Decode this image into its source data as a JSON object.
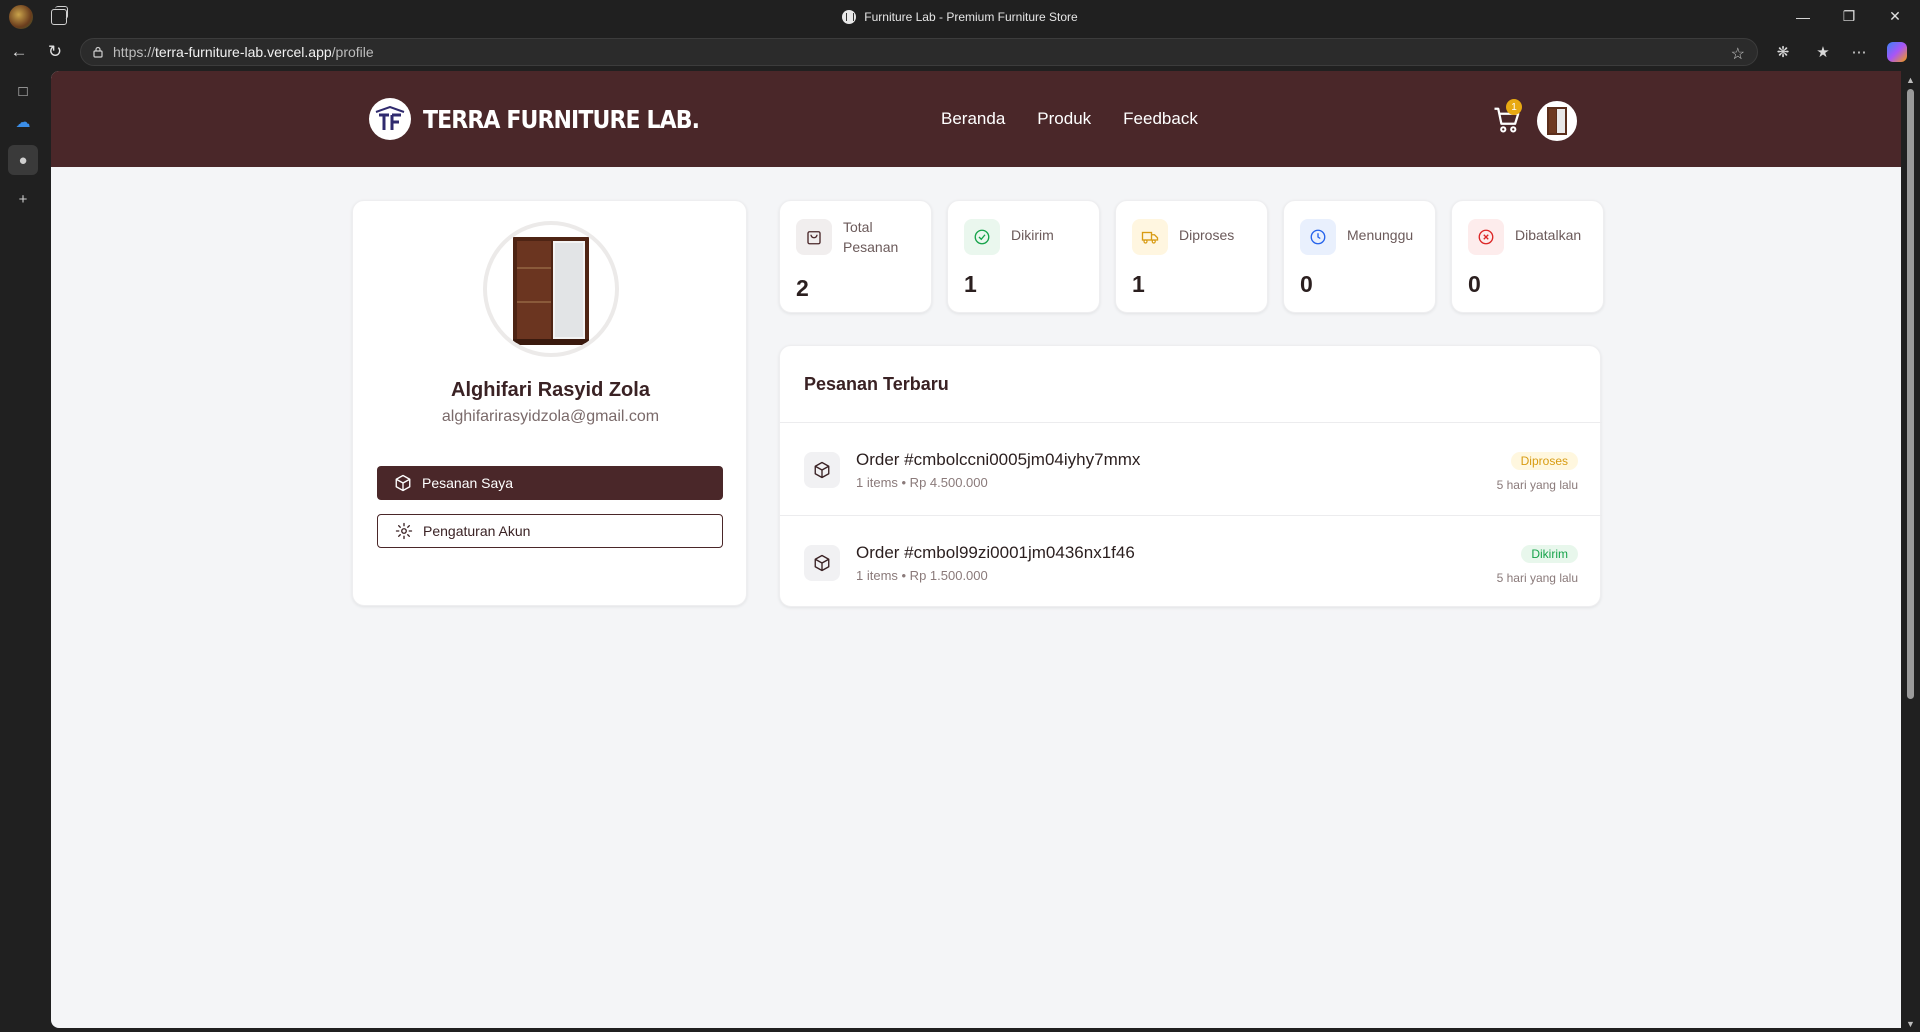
{
  "browser": {
    "tab_title": "Furniture Lab - Premium Furniture Store",
    "url_scheme": "https://",
    "url_host": "terra-furniture-lab.vercel.app",
    "url_path": "/profile"
  },
  "site": {
    "brand": "TERRA FURNITURE LAB.",
    "nav": [
      "Beranda",
      "Produk",
      "Feedback"
    ],
    "cart_count": "1"
  },
  "profile": {
    "name": "Alghifari Rasyid Zola",
    "email": "alghifarirasyidzola@gmail.com",
    "btn_orders": "Pesanan Saya",
    "btn_settings": "Pengaturan Akun"
  },
  "stats": [
    {
      "label_line1": "Total",
      "label_line2": "Pesanan",
      "value": "2",
      "icon": "bag-icon",
      "color": "#6b5a5a"
    },
    {
      "label": "Dikirim",
      "value": "1",
      "icon": "check-circle-icon",
      "color": "#16a34a"
    },
    {
      "label": "Diproses",
      "value": "1",
      "icon": "truck-icon",
      "color": "#d89b12"
    },
    {
      "label": "Menunggu",
      "value": "0",
      "icon": "clock-icon",
      "color": "#2563eb"
    },
    {
      "label": "Dibatalkan",
      "value": "0",
      "icon": "x-circle-icon",
      "color": "#dc2626"
    }
  ],
  "orders": {
    "title": "Pesanan Terbaru",
    "items": [
      {
        "id": "Order #cmbolccni0005jm04iyhy7mmx",
        "meta": "1 items • Rp 4.500.000",
        "status": "Diproses",
        "time": "5 hari yang lalu",
        "status_color": "#d89b12",
        "status_bg": "#fff7df"
      },
      {
        "id": "Order #cmbol99zi0001jm0436nx1f46",
        "meta": "1 items • Rp 1.500.000",
        "status": "Dikirim",
        "time": "5 hari yang lalu",
        "status_color": "#16a34a",
        "status_bg": "#e8f7ec"
      }
    ]
  }
}
